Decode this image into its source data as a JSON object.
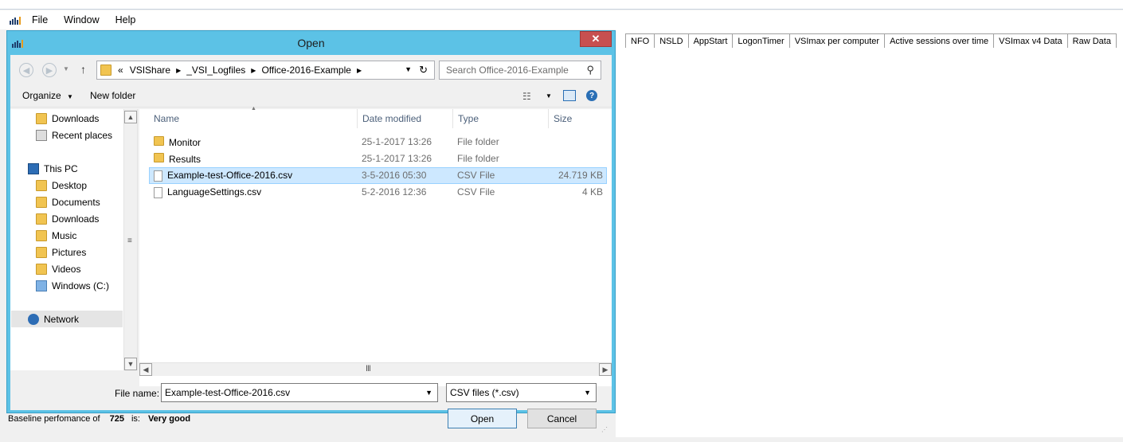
{
  "menubar": {
    "items": [
      "File",
      "Window",
      "Help"
    ]
  },
  "tabs": [
    "NFO",
    "NSLD",
    "AppStart",
    "LogonTimer",
    "VSImax per computer",
    "Active sessions over time",
    "VSImax v4 Data",
    "Raw Data"
  ],
  "status": {
    "prefix": "Baseline perfomance of",
    "value": "725",
    "is": "is:",
    "rating": "Very good"
  },
  "dialog": {
    "title": "Open",
    "close_label": "✕",
    "address": {
      "prefix": "«",
      "segments": [
        "VSIShare",
        "_VSI_Logfiles",
        "Office-2016-Example"
      ]
    },
    "search_placeholder": "Search Office-2016-Example",
    "toolbar": {
      "organize": "Organize",
      "new_folder": "New folder"
    },
    "nav": {
      "downloads_top": "Downloads",
      "recent": "Recent places",
      "this_pc": "This PC",
      "desktop": "Desktop",
      "documents": "Documents",
      "downloads": "Downloads",
      "music": "Music",
      "pictures": "Pictures",
      "videos": "Videos",
      "windows_c": "Windows (C:)",
      "network": "Network"
    },
    "columns": {
      "name": "Name",
      "date": "Date modified",
      "type": "Type",
      "size": "Size"
    },
    "files": [
      {
        "name": "Monitor",
        "date": "25-1-2017 13:26",
        "type": "File folder",
        "size": ""
      },
      {
        "name": "Results",
        "date": "25-1-2017 13:26",
        "type": "File folder",
        "size": ""
      },
      {
        "name": "Example-test-Office-2016.csv",
        "date": "3-5-2016 05:30",
        "type": "CSV File",
        "size": "24.719 KB"
      },
      {
        "name": "LanguageSettings.csv",
        "date": "5-2-2016 12:36",
        "type": "CSV File",
        "size": "4 KB"
      }
    ],
    "filename_label": "File name:",
    "filename_value": "Example-test-Office-2016.csv",
    "filetype_value": "CSV files (*.csv)",
    "open_label": "Open",
    "cancel_label": "Cancel"
  }
}
